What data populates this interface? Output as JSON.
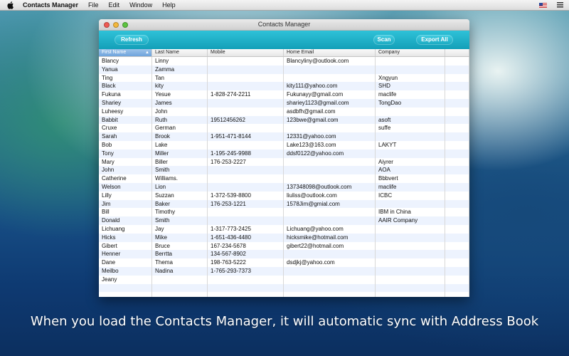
{
  "menubar": {
    "app_name": "Contacts Manager",
    "items": [
      "File",
      "Edit",
      "Window",
      "Help"
    ]
  },
  "window": {
    "title": "Contacts Manager"
  },
  "toolbar": {
    "refresh_label": "Refresh",
    "scan_label": "Scan",
    "export_label": "Export All"
  },
  "table": {
    "columns": [
      "First Name",
      "Last Name",
      "Mobile",
      "Home Email",
      "Company",
      ""
    ],
    "rows": [
      [
        "Blancy",
        "Linny",
        "",
        "Blancyliny@outlook.com",
        "",
        ""
      ],
      [
        "Yanua",
        "Zamma",
        "",
        "",
        "",
        ""
      ],
      [
        "Ting",
        "Tan",
        "",
        "",
        "Xngyun",
        ""
      ],
      [
        "Black",
        "kity",
        "",
        "kity111@yahoo.com",
        "SHD",
        ""
      ],
      [
        "Fukuna",
        "Yesue",
        "1-828-274-2211",
        "Fukunayy@gmail.com",
        "maclife",
        ""
      ],
      [
        "Shariey",
        "James",
        "",
        "shariey1123@gmail.com",
        "TongDao",
        ""
      ],
      [
        "Luheesy",
        "John",
        "",
        "asdbfh@gmail.com",
        "",
        ""
      ],
      [
        "Babbit",
        "Ruth",
        "19512456262",
        "123bwe@gmail.com",
        "asoft",
        ""
      ],
      [
        "Cruxe",
        "German",
        "",
        "",
        "suffe",
        ""
      ],
      [
        "Sarah",
        "Brook",
        "1-951-471-8144",
        "12331@yahoo.com",
        "",
        ""
      ],
      [
        "Bob",
        "Lake",
        "",
        "Lake123@163.com",
        "LAKYT",
        ""
      ],
      [
        "Tony",
        "Miller",
        "1-195-245-9988",
        "ddsf0122@yahoo.com",
        "",
        ""
      ],
      [
        "Mary",
        "Biller",
        "176-253-2227",
        "",
        "Aiyrer",
        ""
      ],
      [
        "John",
        "Smith",
        "",
        "",
        "AOA",
        ""
      ],
      [
        "Catherine",
        "Williams.",
        "",
        "",
        "Bbbvert",
        ""
      ],
      [
        "Welson",
        "Lion",
        "",
        "137348098@outlook.com",
        "maclife",
        ""
      ],
      [
        "Lilly",
        "Suzzan",
        "1-372-539-8800",
        "liuliss@outlook.com",
        "ICBC",
        ""
      ],
      [
        "Jim",
        "Baker",
        "176-253-1221",
        "1578Jim@gmial.com",
        "",
        ""
      ],
      [
        "Bill",
        "Timothy",
        "",
        "",
        "IBM in China",
        ""
      ],
      [
        "Donald",
        "Smith",
        "",
        "",
        "AAIR Company",
        ""
      ],
      [
        "Lichuang",
        "Jay",
        "1-317-773-2425",
        "Lichuang@yahoo.com",
        "",
        ""
      ],
      [
        "Hicks",
        "Mike",
        "1-651-436-4480",
        "hicksmike@hotmail.com",
        "",
        ""
      ],
      [
        "Gibert",
        "Bruce",
        "167-234-5678",
        "gibert22@hotmail.com",
        "",
        ""
      ],
      [
        "Henner",
        "Berrtta",
        "134-567-8902",
        "",
        "",
        ""
      ],
      [
        "Dane",
        "Thema",
        "198-763-5222",
        "dsdjkj@yahoo.com",
        "",
        ""
      ],
      [
        "Meilbo",
        "Nadina",
        "1-765-293-7373",
        "",
        "",
        ""
      ],
      [
        "Jeany",
        "",
        "",
        "",
        "",
        ""
      ],
      [
        "",
        "",
        "",
        "",
        "",
        ""
      ],
      [
        "",
        "",
        "",
        "",
        "",
        ""
      ]
    ]
  },
  "caption": "When you load the Contacts Manager, it will automatic sync with Address Book",
  "colors": {
    "toolbar": "#1fb0c8",
    "row_alt": "#edf3fe",
    "sorted_header": "#7fb0e2"
  }
}
